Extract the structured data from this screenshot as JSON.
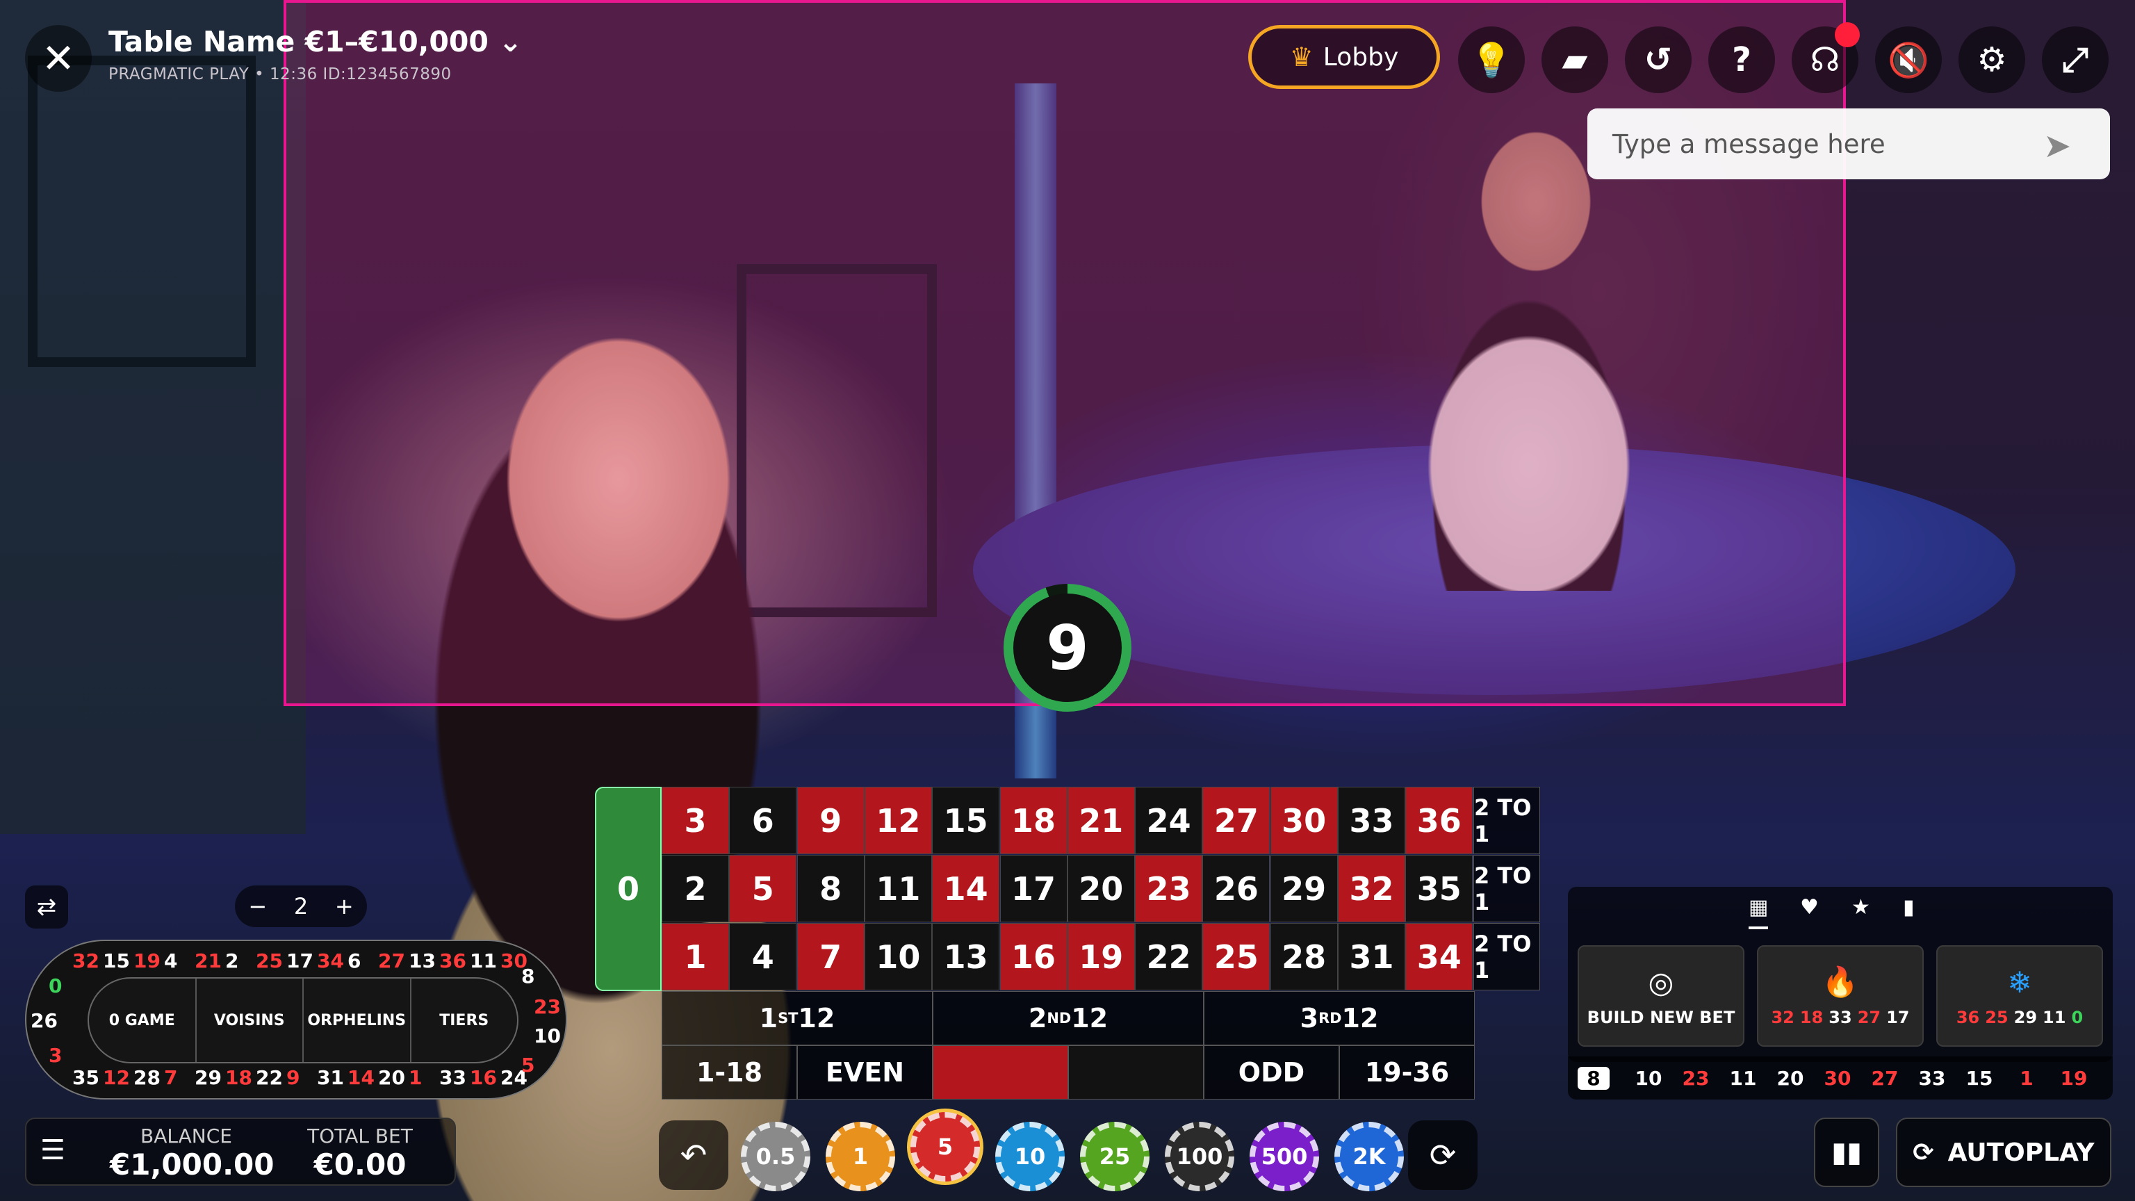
{
  "header": {
    "close_icon": "close-icon",
    "table_name": "Table Name €1–€10,000",
    "subtitle": "PRAGMATIC PLAY •  12:36  ID:1234567890",
    "lobby_label": "Lobby",
    "buttons": [
      "lightbulb-icon",
      "chat-icon",
      "history-icon",
      "help-icon",
      "support-icon",
      "mute-icon",
      "gear-icon",
      "fullscreen-icon"
    ]
  },
  "chat": {
    "placeholder": "Type a message here"
  },
  "timer": {
    "value": "9"
  },
  "board": {
    "zero": "0",
    "rows": [
      [
        "3",
        "6",
        "9",
        "12",
        "15",
        "18",
        "21",
        "24",
        "27",
        "30",
        "33",
        "36"
      ],
      [
        "2",
        "5",
        "8",
        "11",
        "14",
        "17",
        "20",
        "23",
        "26",
        "29",
        "32",
        "35"
      ],
      [
        "1",
        "4",
        "7",
        "10",
        "13",
        "16",
        "19",
        "22",
        "25",
        "28",
        "31",
        "34"
      ]
    ],
    "red_numbers": [
      "1",
      "3",
      "5",
      "7",
      "9",
      "12",
      "14",
      "16",
      "18",
      "19",
      "21",
      "23",
      "25",
      "27",
      "30",
      "32",
      "34",
      "36"
    ],
    "col_bets": [
      "2 TO 1",
      "2 TO 1",
      "2 TO 1"
    ],
    "dozens": [
      "12",
      "12",
      "12"
    ],
    "dozen_prefixes": [
      "1",
      "2",
      "3"
    ],
    "dozen_sups": [
      "ST",
      "ND",
      "RD"
    ],
    "evens": [
      "1-18",
      "EVEN",
      "",
      "",
      "ODD",
      "19-36"
    ]
  },
  "racetrack": {
    "sections": [
      "0 GAME",
      "VOISINS",
      "ORPHELINS",
      "TIERS"
    ],
    "top": [
      "32",
      "15",
      "19",
      "4",
      "21",
      "2",
      "25",
      "17",
      "34",
      "6",
      "27",
      "13",
      "36",
      "11",
      "30"
    ],
    "bottom": [
      "35",
      "12",
      "28",
      "7",
      "29",
      "18",
      "22",
      "9",
      "31",
      "14",
      "20",
      "1",
      "33",
      "16",
      "24"
    ],
    "left": [
      "0",
      "26",
      "3"
    ],
    "right": [
      "8",
      "23",
      "10",
      "5"
    ],
    "neighbours": "2"
  },
  "balance": {
    "balance_label": "BALANCE",
    "balance_value": "€1,000.00",
    "total_bet_label": "TOTAL BET",
    "total_bet_value": "€0.00"
  },
  "chips": [
    {
      "label": "0.5",
      "color": "#8a8a8a"
    },
    {
      "label": "1",
      "color": "#e8911c"
    },
    {
      "label": "5",
      "color": "#d42a2a"
    },
    {
      "label": "10",
      "color": "#1a8fd6"
    },
    {
      "label": "25",
      "color": "#55a521"
    },
    {
      "label": "100",
      "color": "#2b2b2b"
    },
    {
      "label": "500",
      "color": "#7a1fc9"
    },
    {
      "label": "2K",
      "color": "#1f67d6"
    }
  ],
  "panel": {
    "tabs": [
      "grid-icon",
      "heart-icon",
      "star-icon",
      "stats-icon"
    ],
    "build_label": "BUILD NEW BET",
    "hot_numbers": [
      "32",
      "18",
      "33",
      "27",
      "17"
    ],
    "cold_numbers": [
      "36",
      "25",
      "29",
      "11",
      "0"
    ]
  },
  "history": [
    "8",
    "10",
    "23",
    "11",
    "20",
    "30",
    "27",
    "33",
    "15",
    "1",
    "19"
  ],
  "autoplay_label": "AUTOPLAY",
  "colors": {
    "accent": "#f5a623",
    "overlay": "#e9178f",
    "red": "#b3171d",
    "green": "#2f8a3a"
  }
}
